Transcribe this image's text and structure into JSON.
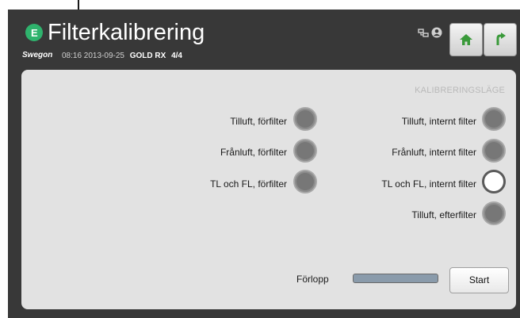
{
  "header": {
    "logo_letter": "E",
    "title": "Filterkalibrering",
    "brand": "Swegon",
    "datetime": "08:16 2013-09-25",
    "unit": "GOLD RX",
    "page": "4/4"
  },
  "panel": {
    "mode_label": "KALIBRERINGSLÄGE",
    "left_options": [
      {
        "label": "Tilluft, förfilter",
        "selected": false
      },
      {
        "label": "Frånluft, förfilter",
        "selected": false
      },
      {
        "label": "TL och FL, förfilter",
        "selected": false
      }
    ],
    "right_options": [
      {
        "label": "Tilluft, internt filter",
        "selected": false
      },
      {
        "label": "Frånluft, internt filter",
        "selected": false
      },
      {
        "label": "TL och FL, internt filter",
        "selected": true
      },
      {
        "label": "Tilluft, efterfilter",
        "selected": false
      }
    ],
    "progress_label": "Förlopp",
    "progress_value": 0,
    "start_label": "Start"
  },
  "colors": {
    "accent": "#2fb36d",
    "nav_icon": "#3a9a3a",
    "screen_bg": "#383838",
    "panel_bg": "#e2e2e2"
  },
  "icons": [
    "app-logo-icon",
    "network-icon",
    "user-icon",
    "home-icon",
    "back-arrow-icon"
  ]
}
